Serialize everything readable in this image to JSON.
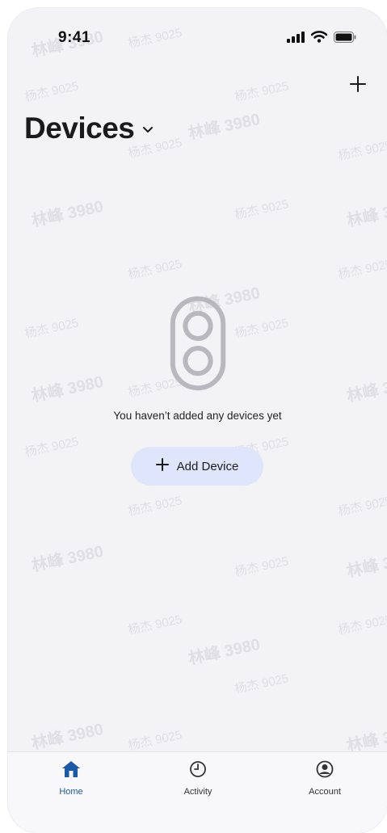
{
  "status_bar": {
    "time": "9:41"
  },
  "header": {
    "title": "Devices"
  },
  "empty_state": {
    "message": "You haven’t added any devices yet"
  },
  "actions": {
    "add_device_label": "Add Device"
  },
  "tabs": [
    {
      "label": "Home",
      "icon": "home-icon",
      "active": true
    },
    {
      "label": "Activity",
      "icon": "clock-icon",
      "active": false
    },
    {
      "label": "Account",
      "icon": "user-circle-icon",
      "active": false
    }
  ],
  "watermark": {
    "text_a": "杨杰 9025",
    "text_b": "林峰 3980"
  },
  "colors": {
    "background": "#f3f3f6",
    "button_bg": "#dfe6fb",
    "accent": "#1c5aa8"
  }
}
